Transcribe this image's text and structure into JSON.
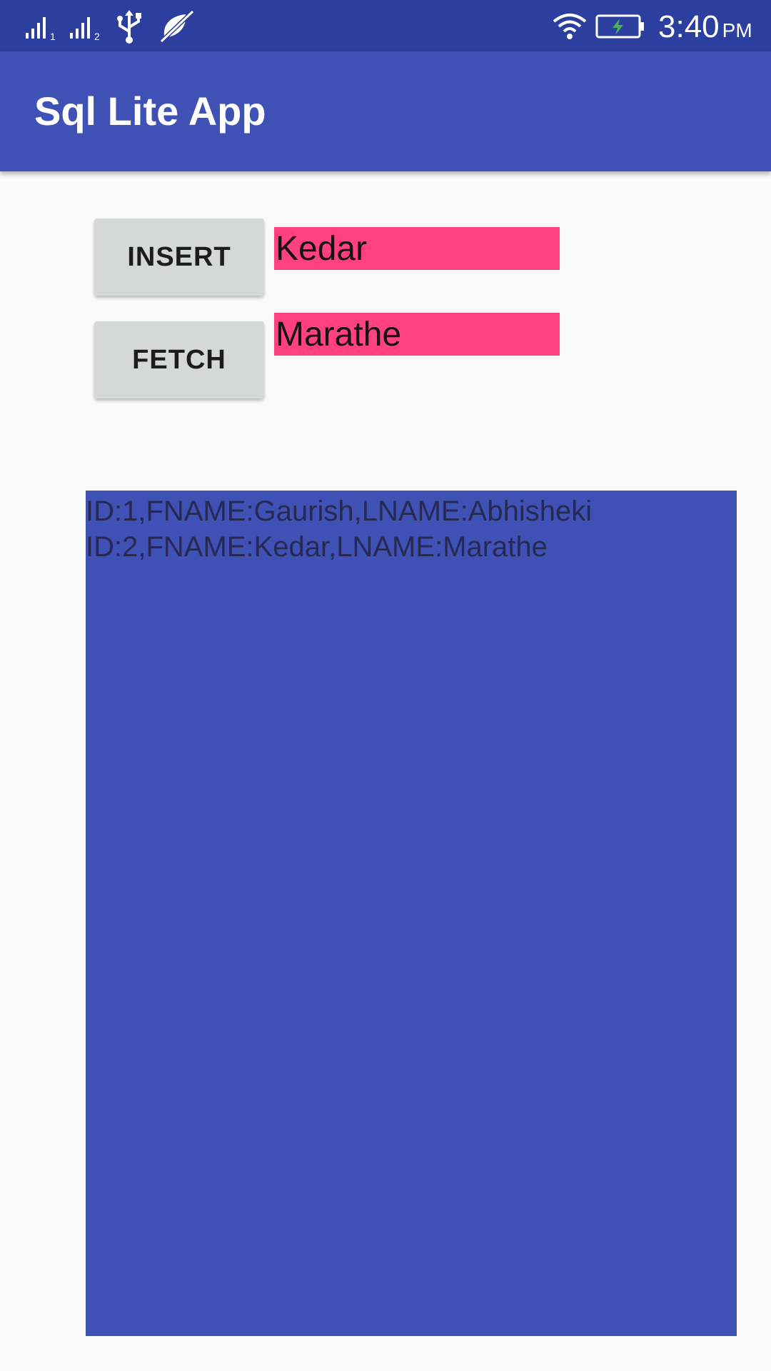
{
  "status_bar": {
    "time": "3:40",
    "ampm": "PM",
    "icons": [
      "signal-sim1-icon",
      "signal-sim2-icon",
      "usb-icon",
      "muted-icon",
      "wifi-icon",
      "battery-charging-icon"
    ],
    "sim1_label": "1",
    "sim2_label": "2"
  },
  "app_bar": {
    "title": "Sql Lite App",
    "color": "#3f51b5"
  },
  "buttons": {
    "insert_label": "INSERT",
    "fetch_label": "FETCH"
  },
  "inputs": {
    "first_name_value": "Kedar",
    "last_name_value": "Marathe",
    "color": "#ff4081"
  },
  "results": {
    "lines": [
      "ID:1,FNAME:Gaurish,LNAME:Abhisheki",
      "ID:2,FNAME:Kedar,LNAME:Marathe"
    ]
  }
}
